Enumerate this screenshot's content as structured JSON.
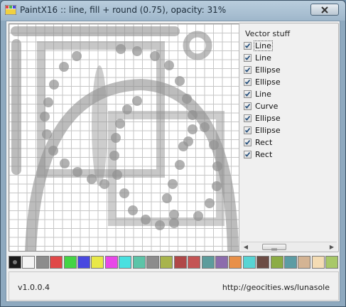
{
  "window": {
    "title": "PaintX16 :: line, fill + round (0.75), opacity: 31%",
    "close_icon": "close-x-icon"
  },
  "panel": {
    "title": "Vector stuff",
    "items": [
      {
        "label": "Line",
        "checked": true,
        "selected": true
      },
      {
        "label": "Line",
        "checked": true
      },
      {
        "label": "Ellipse",
        "checked": true
      },
      {
        "label": "Ellipse",
        "checked": true
      },
      {
        "label": "Line",
        "checked": true
      },
      {
        "label": "Curve",
        "checked": true
      },
      {
        "label": "Ellipse",
        "checked": true
      },
      {
        "label": "Ellipse",
        "checked": true
      },
      {
        "label": "Rect",
        "checked": true
      },
      {
        "label": "Rect",
        "checked": true
      }
    ]
  },
  "palette": {
    "colors": [
      "#1a1a1a",
      "#f4f4f4",
      "#8c8c8c",
      "#e04848",
      "#44d444",
      "#4848e0",
      "#e8e848",
      "#e848e8",
      "#48e0e0",
      "#5cc4a8",
      "#8c8c8c",
      "#a8b44c",
      "#b04848",
      "#c45454",
      "#5c9c9c",
      "#8c6cac",
      "#e89048",
      "#58d4d4",
      "#6c4c44",
      "#8cac44",
      "#5c9ca4",
      "#d4b494",
      "#f4dcb4",
      "#a8c868"
    ]
  },
  "status": {
    "version": "v1.0.0.4",
    "url": "http://geocities.ws/lunasole"
  },
  "colors": {
    "canvas_bg": "#ffffff",
    "grid": "#c6c6c6",
    "shape": "#909090"
  }
}
